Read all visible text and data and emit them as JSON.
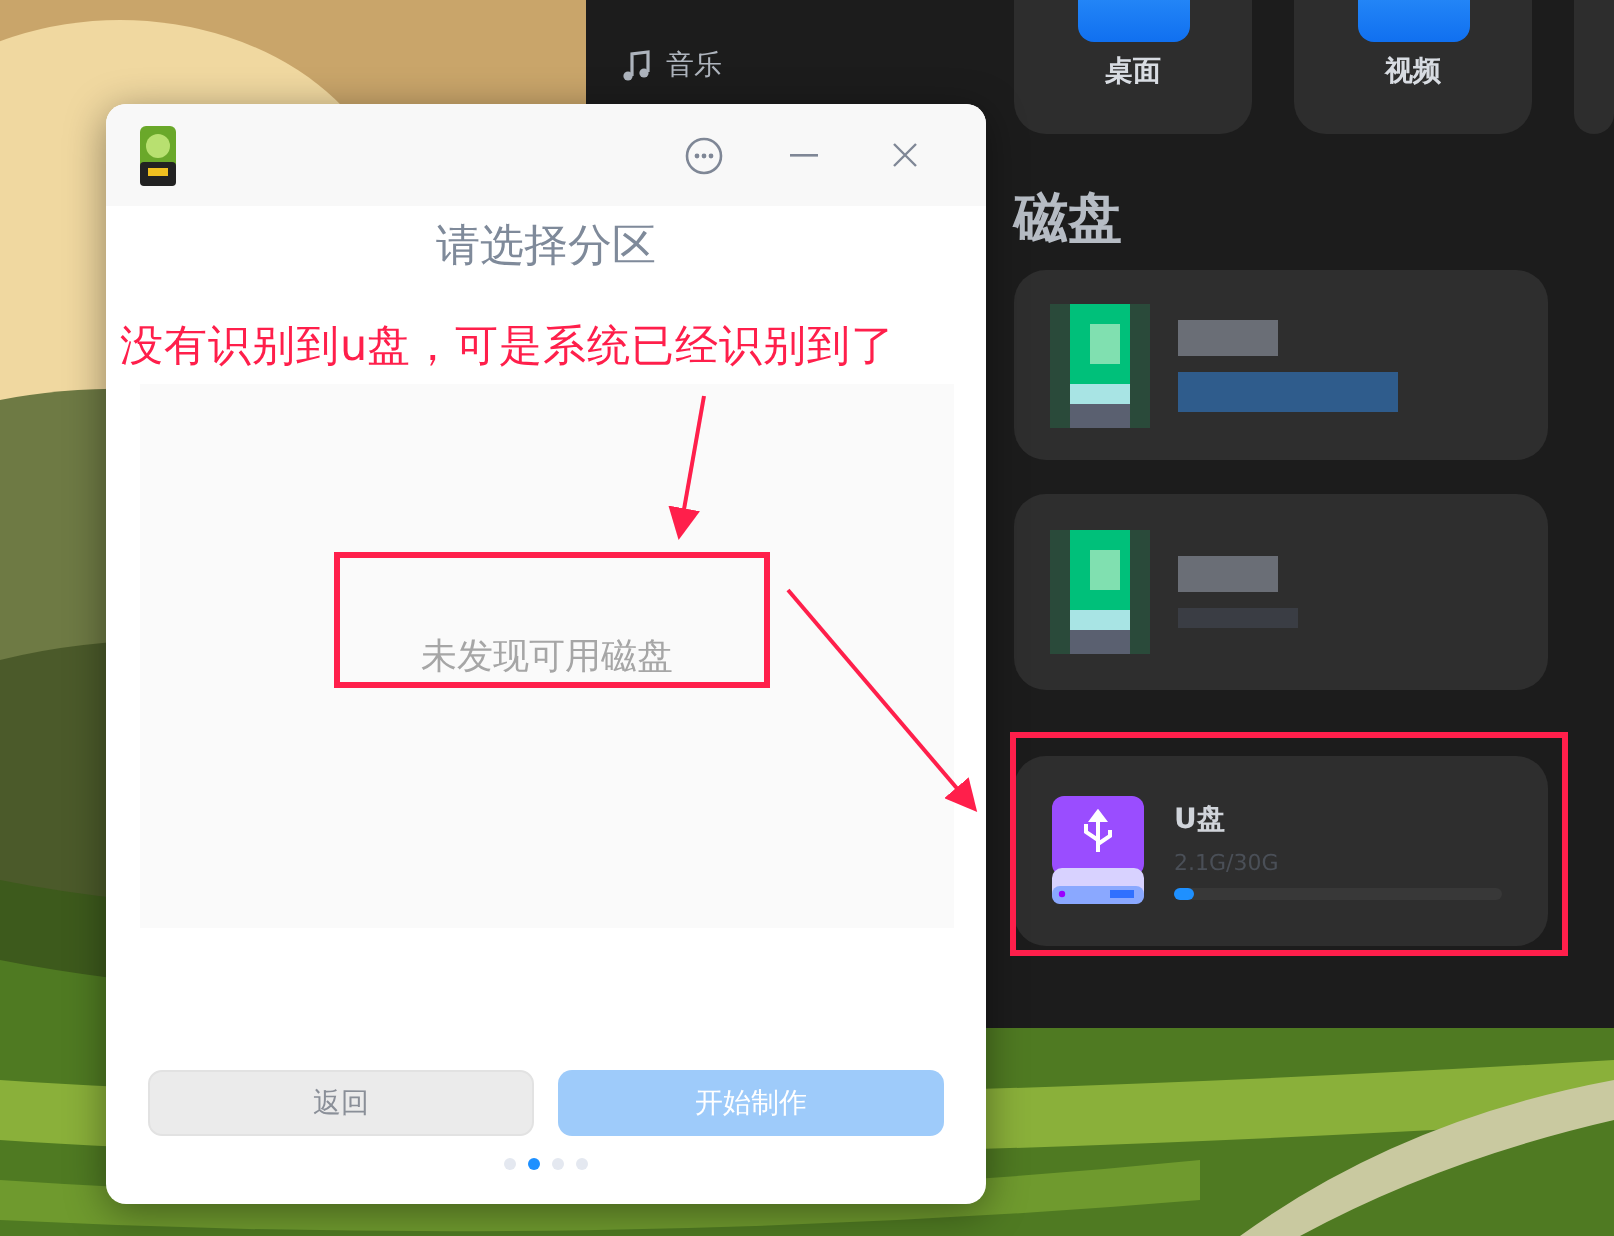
{
  "file_manager": {
    "sidebar": {
      "items": [
        {
          "label": "音乐"
        }
      ]
    },
    "shortcuts": [
      {
        "label": "桌面"
      },
      {
        "label": "视频"
      }
    ],
    "section_title": "磁盘",
    "disks": [
      {
        "kind": "blurred"
      },
      {
        "kind": "blurred"
      },
      {
        "kind": "usb",
        "name": "U盘",
        "usage": "2.1G/30G",
        "level": 0.06
      }
    ]
  },
  "dialog": {
    "title": "请选择分区",
    "message": "未发现可用磁盘",
    "buttons": [
      {
        "label": "返回",
        "kind": "secondary"
      },
      {
        "label": "开始制作",
        "kind": "primary",
        "disabled": true
      }
    ],
    "steps": [
      {
        "selected": false
      },
      {
        "selected": true
      },
      {
        "selected": false
      },
      {
        "selected": false
      }
    ]
  },
  "annotation": {
    "text": "没有识别到u盘，可是系统已经识别到了"
  }
}
